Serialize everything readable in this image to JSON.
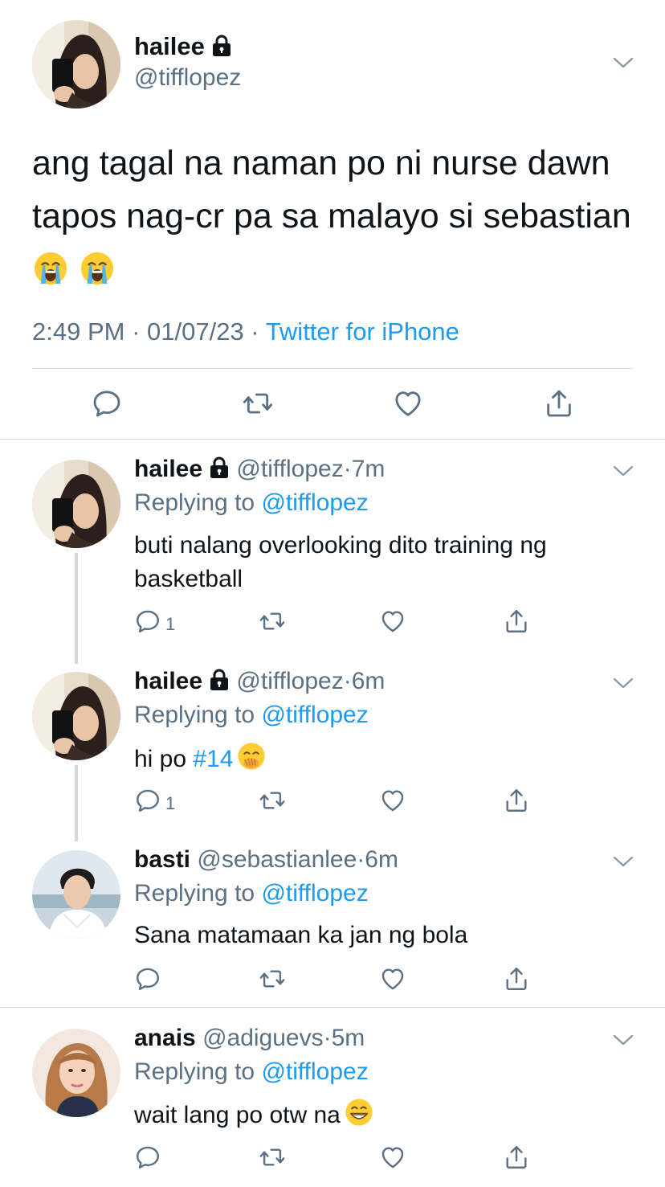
{
  "main_tweet": {
    "name": "hailee",
    "handle": "@tifflopez",
    "text": "ang tagal na naman po ni nurse dawn tapos nag-cr pa sa malayo si sebastian",
    "time": "2:49 PM",
    "sep1": " · ",
    "date": "01/07/23",
    "sep2": " · ",
    "source": "Twitter for iPhone"
  },
  "replies": [
    {
      "name": "hailee",
      "handle": "@tifflopez",
      "dot": "·",
      "time": "7m",
      "replying_label": "Replying to ",
      "replying_handle": "@tifflopez",
      "text": "buti nalang overlooking dito training ng basketball",
      "reply_count": "1"
    },
    {
      "name": "hailee",
      "handle": "@tifflopez",
      "dot": "·",
      "time": "6m",
      "replying_label": "Replying to ",
      "replying_handle": "@tifflopez",
      "text_prefix": "hi po ",
      "hashtag": "#14",
      "reply_count": "1"
    },
    {
      "name": "basti",
      "handle": "@sebastianlee",
      "dot": "·",
      "time": "6m",
      "replying_label": "Replying to ",
      "replying_handle": "@tifflopez",
      "text": "Sana matamaan ka jan ng bola"
    },
    {
      "name": "anais",
      "handle": "@adiguevs",
      "dot": "·",
      "time": "5m",
      "replying_label": "Replying to ",
      "replying_handle": "@tifflopez",
      "text": "wait lang po otw na"
    }
  ],
  "icons": {
    "reply": "comment-icon",
    "retweet": "retweet-icon",
    "like": "heart-icon",
    "share": "share-icon",
    "more": "chevron-down-icon",
    "locked": "lock-icon"
  },
  "colors": {
    "link": "#1d9bf0",
    "secondary_text": "#5b7083",
    "divider": "#d8dde2"
  }
}
